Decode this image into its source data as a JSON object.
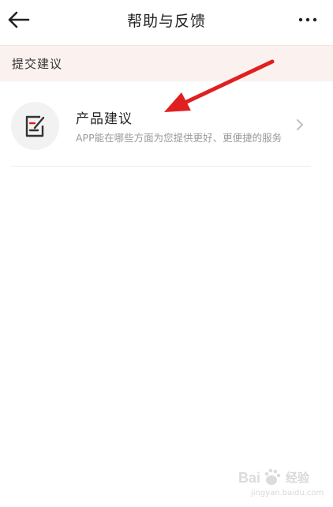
{
  "header": {
    "title": "帮助与反馈",
    "back_icon": "arrow-left-icon",
    "more_icon": "more-horizontal-icon"
  },
  "section": {
    "title": "提交建议"
  },
  "items": [
    {
      "icon": "edit-document-icon",
      "title": "产品建议",
      "description": "APP能在哪些方面为您提供更好、更便捷的服务",
      "chevron_icon": "chevron-right-icon"
    }
  ],
  "watermark": {
    "brand": "Bai du",
    "brand_cn": "经验",
    "url": "jingyan.baidu.com"
  },
  "colors": {
    "section_bg": "#fbf2ef",
    "accent_red": "#e02020",
    "text_primary": "#222222",
    "text_secondary": "#9a9a9a"
  }
}
